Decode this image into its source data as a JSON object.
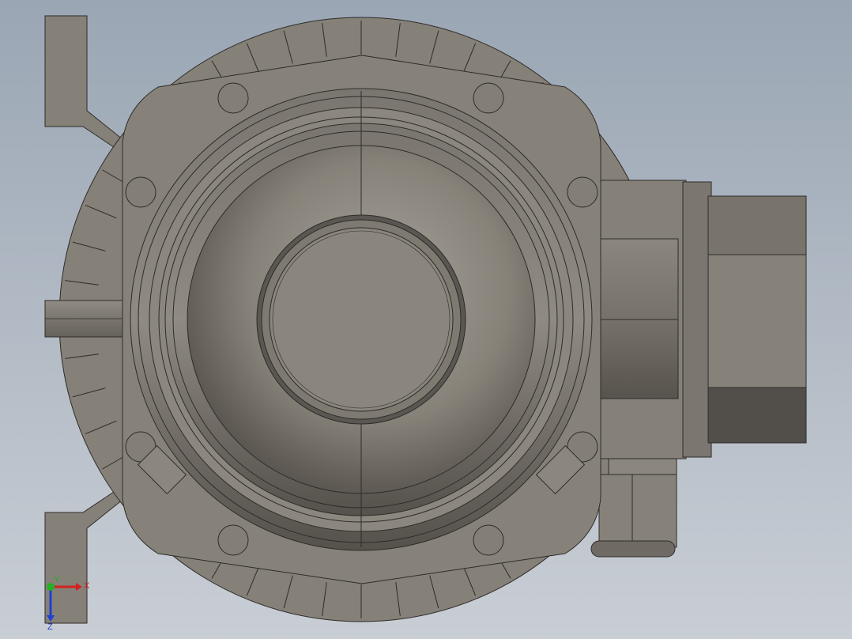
{
  "viewport": {
    "background_top": "#9aa6b4",
    "background_bottom": "#c9ced5"
  },
  "model": {
    "body_color": "#858078",
    "edge_color": "#2e2c29",
    "bolt_count": 8,
    "cooling_fin_count": 48
  },
  "triad": {
    "x_label": "X",
    "y_label": "Y",
    "z_label": "Z",
    "x_color": "#d42020",
    "y_color": "#25b025",
    "z_color": "#2040d0"
  }
}
